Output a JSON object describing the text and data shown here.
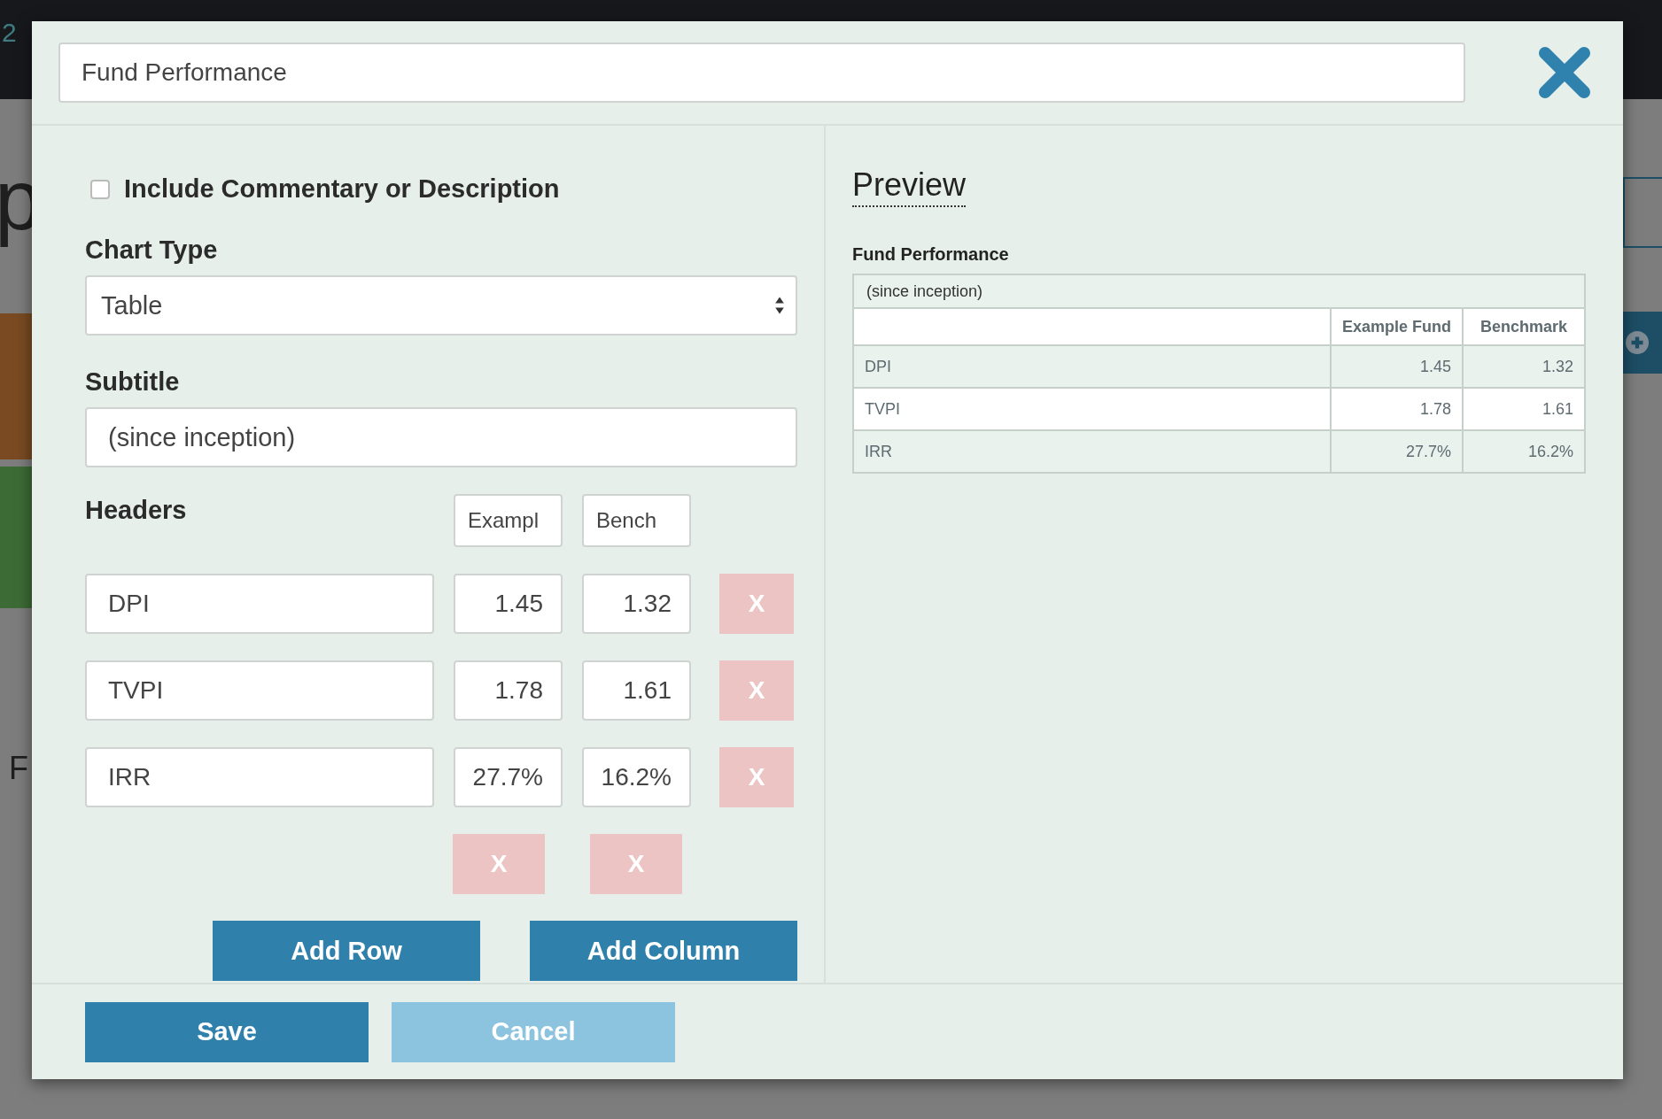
{
  "background": {
    "top_text": "2",
    "heading_fragment": "p",
    "row_fragment": "F"
  },
  "modal": {
    "title_field": {
      "value": "Fund Performance"
    },
    "commentary": {
      "label": "Include Commentary or Description",
      "checked": false
    },
    "chart_type": {
      "label": "Chart Type",
      "value": "Table"
    },
    "subtitle": {
      "label": "Subtitle",
      "value": "(since inception)"
    },
    "headers": {
      "label": "Headers",
      "columns": [
        "Exampl",
        "Bench"
      ]
    },
    "rows": [
      {
        "name": "DPI",
        "values": [
          "1.45",
          "1.32"
        ],
        "delete": "X"
      },
      {
        "name": "TVPI",
        "values": [
          "1.78",
          "1.61"
        ],
        "delete": "X"
      },
      {
        "name": "IRR",
        "values": [
          "27.7%",
          "16.2%"
        ],
        "delete": "X"
      }
    ],
    "column_deletes": [
      "X",
      "X"
    ],
    "add_row": "Add Row",
    "add_column": "Add Column",
    "footer_buttons": [
      {
        "label": "Save",
        "kind": "primary"
      },
      {
        "label": "Cancel",
        "kind": "secondary"
      }
    ],
    "preview": {
      "heading": "Preview",
      "title": "Fund Performance",
      "subtitle": "(since inception)",
      "columns": [
        "Example Fund",
        "Benchmark"
      ],
      "rows": [
        {
          "label": "DPI",
          "values": [
            "1.45",
            "1.32"
          ]
        },
        {
          "label": "TVPI",
          "values": [
            "1.78",
            "1.61"
          ]
        },
        {
          "label": "IRR",
          "values": [
            "27.7%",
            "16.2%"
          ]
        }
      ]
    }
  }
}
